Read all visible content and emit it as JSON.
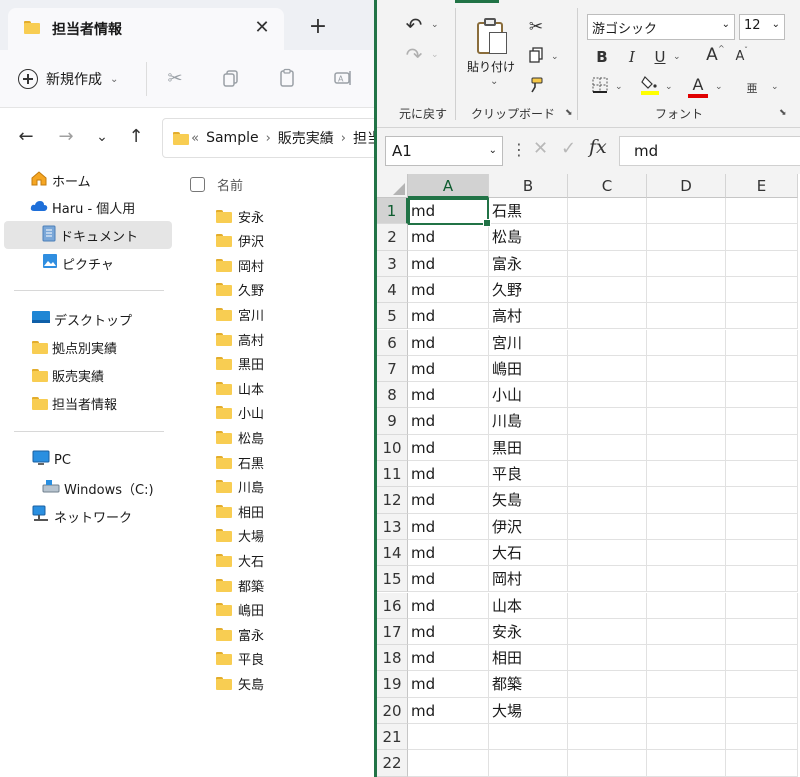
{
  "explorer": {
    "tab_title": "担当者情報",
    "tab_close": "✕",
    "new_tab": "+",
    "new_button": "新規作成",
    "address": {
      "overflow": "«",
      "crumbs": [
        "Sample",
        "販売実績",
        "担当"
      ]
    },
    "nav_pane": {
      "top": [
        {
          "label": "ホーム",
          "icon": "home-icon"
        },
        {
          "label": "Haru - 個人用",
          "icon": "onedrive-cloud-icon"
        },
        {
          "label": "ドキュメント",
          "icon": "documents-icon",
          "selected": true
        },
        {
          "label": "ピクチャ",
          "icon": "pictures-icon"
        }
      ],
      "pinned": [
        {
          "label": "デスクトップ",
          "icon": "desktop-icon"
        },
        {
          "label": "拠点別実績",
          "icon": "folder-icon"
        },
        {
          "label": "販売実績",
          "icon": "folder-icon"
        },
        {
          "label": "担当者情報",
          "icon": "folder-icon"
        }
      ],
      "computer": [
        {
          "label": "PC",
          "icon": "pc-icon"
        },
        {
          "label": "Windows（C:)",
          "icon": "drive-icon"
        },
        {
          "label": "ネットワーク",
          "icon": "network-icon"
        }
      ]
    },
    "column_header": "名前",
    "folders": [
      "安永",
      "伊沢",
      "岡村",
      "久野",
      "宮川",
      "高村",
      "黒田",
      "山本",
      "小山",
      "松島",
      "石黒",
      "川島",
      "相田",
      "大場",
      "大石",
      "都築",
      "嶋田",
      "富永",
      "平良",
      "矢島"
    ]
  },
  "excel": {
    "undo_group_label": "元に戻す",
    "paste_label": "貼り付け",
    "clipboard_label": "クリップボード",
    "font_group_label": "フォント",
    "font_name": "游ゴシック",
    "font_size": "12",
    "bold": "B",
    "italic": "I",
    "underline": "U",
    "grow": "A",
    "shrink": "A",
    "fontcolor": "A",
    "phonetic": "亜",
    "name_box": "A1",
    "fx": "fx",
    "formula_value": "md",
    "columns": [
      "A",
      "B",
      "C",
      "D",
      "E"
    ],
    "rows": [
      {
        "n": "1",
        "a": "md",
        "b": "石黒"
      },
      {
        "n": "2",
        "a": "md",
        "b": "松島"
      },
      {
        "n": "3",
        "a": "md",
        "b": "富永"
      },
      {
        "n": "4",
        "a": "md",
        "b": "久野"
      },
      {
        "n": "5",
        "a": "md",
        "b": "高村"
      },
      {
        "n": "6",
        "a": "md",
        "b": "宮川"
      },
      {
        "n": "7",
        "a": "md",
        "b": "嶋田"
      },
      {
        "n": "8",
        "a": "md",
        "b": "小山"
      },
      {
        "n": "9",
        "a": "md",
        "b": "川島"
      },
      {
        "n": "10",
        "a": "md",
        "b": "黒田"
      },
      {
        "n": "11",
        "a": "md",
        "b": "平良"
      },
      {
        "n": "12",
        "a": "md",
        "b": "矢島"
      },
      {
        "n": "13",
        "a": "md",
        "b": "伊沢"
      },
      {
        "n": "14",
        "a": "md",
        "b": "大石"
      },
      {
        "n": "15",
        "a": "md",
        "b": "岡村"
      },
      {
        "n": "16",
        "a": "md",
        "b": "山本"
      },
      {
        "n": "17",
        "a": "md",
        "b": "安永"
      },
      {
        "n": "18",
        "a": "md",
        "b": "相田"
      },
      {
        "n": "19",
        "a": "md",
        "b": "都築"
      },
      {
        "n": "20",
        "a": "md",
        "b": "大場"
      },
      {
        "n": "21",
        "a": "",
        "b": ""
      },
      {
        "n": "22",
        "a": "",
        "b": ""
      }
    ],
    "accent_color": "#217346"
  }
}
